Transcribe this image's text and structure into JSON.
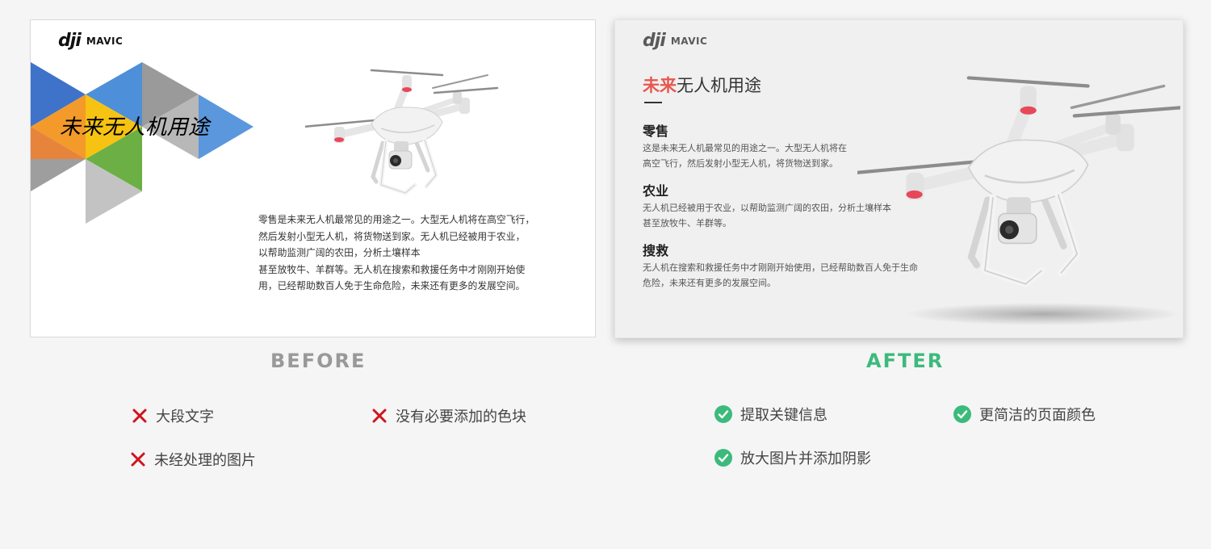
{
  "brand": {
    "logo_mark": "dji",
    "logo_text": "MAVIC"
  },
  "before": {
    "title": "未来无人机用途",
    "body_lines": [
      "零售是未来无人机最常见的用途之一。大型无人机将在高空飞行，",
      "然后发射小型无人机，将货物送到家。无人机已经被用于农业，",
      "以帮助监测广阔的农田，分析土壤样本",
      "甚至放牧牛、羊群等。无人机在搜索和救援任务中才刚刚开始使",
      "用，已经帮助数百人免于生命危险，未来还有更多的发展空间。"
    ],
    "label": "BEFORE",
    "notes": [
      "大段文字",
      "没有必要添加的色块",
      "未经处理的图片"
    ]
  },
  "after": {
    "title_accent": "未来",
    "title_rest": "无人机用途",
    "sections": [
      {
        "heading": "零售",
        "lines": [
          "这是未来无人机最常见的用途之一。大型无人机将在",
          "高空飞行，然后发射小型无人机，将货物送到家。"
        ]
      },
      {
        "heading": "农业",
        "lines": [
          "无人机已经被用于农业，以帮助监测广阔的农田，分析土壤样本",
          "甚至放牧牛、羊群等。"
        ]
      },
      {
        "heading": "搜救",
        "lines": [
          "无人机在搜索和救援任务中才刚刚开始使用，已经帮助数百人免于生命",
          "危险，未来还有更多的发展空间。"
        ]
      }
    ],
    "label": "AFTER",
    "notes": [
      "提取关键信息",
      "更简洁的页面颜色",
      "放大图片并添加阴影"
    ]
  },
  "colors": {
    "accent_red": "#e8574f",
    "after_green": "#3cba7c",
    "before_gray": "#999999",
    "cross_red": "#d0141e"
  },
  "icons": {
    "bad": "cross-icon",
    "good": "check-circle-icon"
  }
}
